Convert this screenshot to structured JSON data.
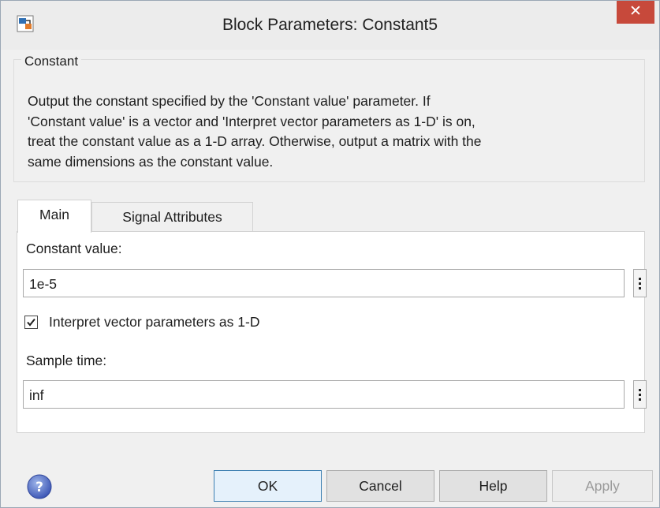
{
  "window": {
    "title": "Block Parameters: Constant5",
    "close_label": "✕"
  },
  "group": {
    "title": "Constant",
    "description_lines": [
      "Output the constant specified by the 'Constant value' parameter. If",
      "'Constant value' is a vector and 'Interpret vector parameters as 1-D' is on,",
      "treat the constant value as a 1-D array. Otherwise, output a matrix with the",
      "same dimensions as the constant value."
    ]
  },
  "tabs": [
    {
      "label": "Main",
      "active": true
    },
    {
      "label": "Signal Attributes",
      "active": false
    }
  ],
  "main": {
    "constant_value_label": "Constant value:",
    "constant_value": "1e-5",
    "interpret_checkbox_label": "Interpret vector parameters as 1-D",
    "interpret_checked": true,
    "sample_time_label": "Sample time:",
    "sample_time_value": "inf"
  },
  "buttons": {
    "ok": "OK",
    "cancel": "Cancel",
    "help": "Help",
    "apply": "Apply",
    "apply_enabled": false
  },
  "colors": {
    "close_button": "#c7493b",
    "dialog_background": "#f0f0f0",
    "ok_button_border": "#3c7fb1"
  },
  "icons": {
    "app": "simulink-block-icon",
    "help": "help-circle-icon",
    "more": "vertical-ellipsis-icon",
    "check": "checkmark-icon"
  }
}
